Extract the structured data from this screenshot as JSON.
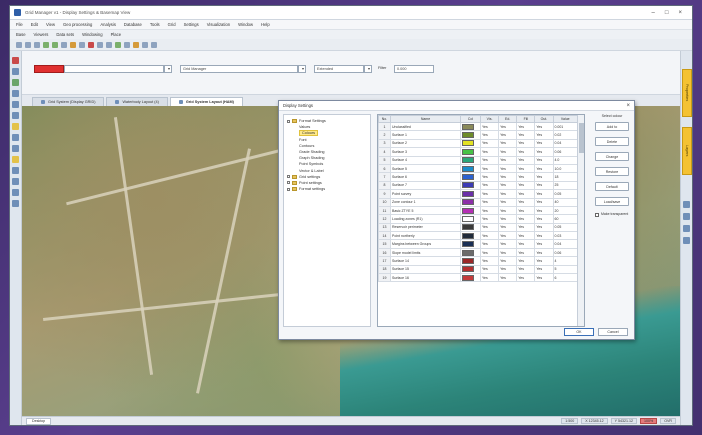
{
  "window": {
    "title": "Grid Manager v1 - Display Settings & Basemap View"
  },
  "menu": [
    "File",
    "Edit",
    "View",
    "Geo processing",
    "Analysis",
    "Database",
    "Tools",
    "Grid",
    "Settings",
    "Visualization",
    "Window",
    "Help"
  ],
  "ribbon_tabs": [
    "Base",
    "Viewers",
    "Data sets",
    "Windowing",
    "Place"
  ],
  "search": {
    "field_value": "",
    "layer_value": "Grid Manager",
    "mode_value": "Extended",
    "filter_label": "Filter",
    "filter_value": "0.000"
  },
  "doc_tabs": [
    {
      "label": "Grid System (Display GRID)"
    },
    {
      "label": "Waterbody Layout (4)"
    },
    {
      "label": "Grid System Layout (HAM)"
    }
  ],
  "dialog": {
    "title": "Display Settings",
    "close": "×",
    "tree": [
      {
        "label": "Format Settings",
        "level": 0
      },
      {
        "label": "Values",
        "level": 1
      },
      {
        "label": "Colours",
        "level": 1,
        "selected": true
      },
      {
        "label": "Font",
        "level": 1
      },
      {
        "label": "Contours",
        "level": 1
      },
      {
        "label": "Grade Shading",
        "level": 1
      },
      {
        "label": "Graph Shading",
        "level": 1
      },
      {
        "label": "Point Symbols",
        "level": 1
      },
      {
        "label": "Vector & Label",
        "level": 1
      },
      {
        "label": "Grid settings",
        "level": 0
      },
      {
        "label": "Point settings",
        "level": 0
      },
      {
        "label": "Format settings",
        "level": 0
      }
    ],
    "grid_headers": [
      "No.",
      "Name",
      "Col",
      "Vis.",
      "Ed.",
      "Fill",
      "Out.",
      "Value"
    ],
    "rows": [
      {
        "no": "1",
        "name": "Unclassified",
        "color": "#8a8a5a",
        "vis": "Yes",
        "ed": "Yes",
        "fill": "Yes",
        "out": "Yes",
        "value": "0.001"
      },
      {
        "no": "2",
        "name": "Surface 1",
        "color": "#6e8c2a",
        "vis": "Yes",
        "ed": "Yes",
        "fill": "Yes",
        "out": "Yes",
        "value": "0.02"
      },
      {
        "no": "3",
        "name": "Surface 2",
        "color": "#e2e224",
        "vis": "Yes",
        "ed": "Yes",
        "fill": "Yes",
        "out": "Yes",
        "value": "0.04"
      },
      {
        "no": "4",
        "name": "Surface 3",
        "color": "#47c247",
        "vis": "Yes",
        "ed": "Yes",
        "fill": "Yes",
        "out": "Yes",
        "value": "0.06"
      },
      {
        "no": "5",
        "name": "Surface 4",
        "color": "#2aa87a",
        "vis": "Yes",
        "ed": "Yes",
        "fill": "Yes",
        "out": "Yes",
        "value": "4.0"
      },
      {
        "no": "6",
        "name": "Surface 5",
        "color": "#1c8cc9",
        "vis": "Yes",
        "ed": "Yes",
        "fill": "Yes",
        "out": "Yes",
        "value": "10.0"
      },
      {
        "no": "7",
        "name": "Surface 6",
        "color": "#2c62d0",
        "vis": "Yes",
        "ed": "Yes",
        "fill": "Yes",
        "out": "Yes",
        "value": "18"
      },
      {
        "no": "8",
        "name": "Surface 7",
        "color": "#3b3bb5",
        "vis": "Yes",
        "ed": "Yes",
        "fill": "Yes",
        "out": "Yes",
        "value": "25"
      },
      {
        "no": "9",
        "name": "Point survey",
        "color": "#6a2fa8",
        "vis": "Yes",
        "ed": "Yes",
        "fill": "Yes",
        "out": "Yes",
        "value": "0.05"
      },
      {
        "no": "10",
        "name": "Zone contour 1",
        "color": "#8c2fa8",
        "vis": "Yes",
        "ed": "Yes",
        "fill": "Yes",
        "out": "Yes",
        "value": "40"
      },
      {
        "no": "11",
        "name": "Basic ZTYE 5",
        "color": "#b42fb4",
        "vis": "Yes",
        "ed": "Yes",
        "fill": "Yes",
        "out": "Yes",
        "value": "20"
      },
      {
        "no": "12",
        "name": "Loading zones (R1)",
        "color": "#ffffff",
        "vis": "Yes",
        "ed": "Yes",
        "fill": "Yes",
        "out": "Yes",
        "value": "60"
      },
      {
        "no": "13",
        "name": "Reservoir perimeter",
        "color": "#3a3a3a",
        "vis": "Yes",
        "ed": "Yes",
        "fill": "Yes",
        "out": "Yes",
        "value": "0.05"
      },
      {
        "no": "14",
        "name": "Point northerly",
        "color": "#1f2a3a",
        "vis": "Yes",
        "ed": "Yes",
        "fill": "Yes",
        "out": "Yes",
        "value": "0.03"
      },
      {
        "no": "15",
        "name": "Margins between Groups",
        "color": "#1a2f55",
        "vis": "Yes",
        "ed": "Yes",
        "fill": "Yes",
        "out": "Yes",
        "value": "0.04"
      },
      {
        "no": "16",
        "name": "Slope model limits",
        "color": "#6b6b6b",
        "vis": "Yes",
        "ed": "Yes",
        "fill": "Yes",
        "out": "Yes",
        "value": "0.06"
      },
      {
        "no": "17",
        "name": "Surface 14",
        "color": "#9a2828",
        "vis": "Yes",
        "ed": "Yes",
        "fill": "Yes",
        "out": "Yes",
        "value": "4"
      },
      {
        "no": "18",
        "name": "Surface 15",
        "color": "#b53030",
        "vis": "Yes",
        "ed": "Yes",
        "fill": "Yes",
        "out": "Yes",
        "value": "5"
      },
      {
        "no": "19",
        "name": "Surface 16",
        "color": "#c43b3b",
        "vis": "Yes",
        "ed": "Yes",
        "fill": "Yes",
        "out": "Yes",
        "value": "6"
      }
    ],
    "side_title": "Select colour",
    "side_buttons": [
      "Add to",
      "Delete",
      "Change",
      "Restore",
      "Default",
      "Load/save"
    ],
    "checkbox_label": "Make transparent",
    "footer": {
      "ok": "OK",
      "cancel": "Cancel"
    }
  },
  "statusbar": {
    "tab": "Desktop",
    "items": [
      "1:500",
      "X 12345.12",
      "Y 54321.12",
      "100%",
      "OVR"
    ]
  },
  "right_dock": {
    "tab1": "Properties",
    "tab2": "Layers"
  }
}
